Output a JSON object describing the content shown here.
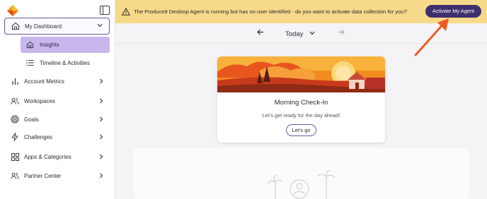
{
  "sidebar": {
    "logo": "produce8-diamond-logo",
    "collapse_icon": "sidebar-toggle-icon",
    "dashboard": {
      "label": "My Dashboard",
      "icon": "home-icon"
    },
    "subitems": [
      {
        "label": "Insights",
        "icon": "home-icon",
        "active": true
      },
      {
        "label": "Timeline & Activities",
        "icon": "list-icon"
      }
    ],
    "items": [
      {
        "label": "Account Metrics",
        "icon": "bar-chart-icon"
      },
      {
        "label": "Workspaces",
        "icon": "users-icon"
      },
      {
        "label": "Goals",
        "icon": "target-icon"
      },
      {
        "label": "Challenges",
        "icon": "lightning-icon"
      },
      {
        "label": "Apps & Categories",
        "icon": "grid-icon"
      },
      {
        "label": "Partner Center",
        "icon": "users-icon"
      }
    ]
  },
  "banner": {
    "message": "The Produce8 Desktop Agent is running but has no user identified - do you want to activate data collection for you?",
    "button": "Activate My Agent",
    "background": "#f7d98a",
    "button_color": "#3e2f6e"
  },
  "date_nav": {
    "label": "Today"
  },
  "card": {
    "title": "Morning Check-In",
    "subtitle": "Let's get ready for the day ahead!",
    "button": "Let's go"
  },
  "colors": {
    "accent": "#6a5aa8",
    "active_bg": "#c9b6ec",
    "annotation": "#f05a22"
  }
}
